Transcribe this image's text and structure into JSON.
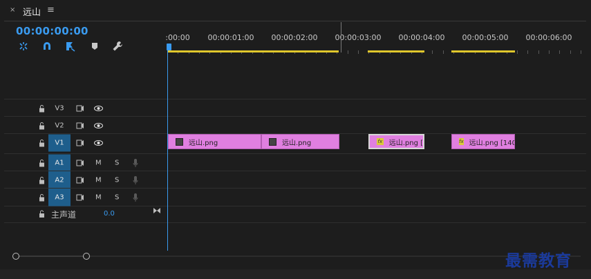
{
  "tab": {
    "close_glyph": "×",
    "title": "远山",
    "menu_glyph": "≡"
  },
  "timecode": "00:00:00:00",
  "tools": [
    "snap-in-icon",
    "linked-selection-icon",
    "add-marker-icon",
    "marker-icon",
    "wrench-settings-icon"
  ],
  "ruler": {
    "labels": [
      ":00:00",
      "00:00:01:00",
      "00:00:02:00",
      "00:00:03:00",
      "00:00:04:00",
      "00:00:05:00",
      "00:00:06:00"
    ]
  },
  "tracks": {
    "v3": {
      "label": "V3"
    },
    "v2": {
      "label": "V2"
    },
    "v1": {
      "label": "V1"
    },
    "a1": {
      "label": "A1",
      "mute": "M",
      "solo": "S"
    },
    "a2": {
      "label": "A2",
      "mute": "M",
      "solo": "S"
    },
    "a3": {
      "label": "A3",
      "mute": "M",
      "solo": "S"
    }
  },
  "master": {
    "label": "主声道",
    "value": "0.0"
  },
  "clips": [
    {
      "name": "远山.png",
      "icon": "image-icon"
    },
    {
      "name": "远山.png",
      "icon": "image-icon"
    },
    {
      "name": "远山.png [",
      "icon": "fx-icon",
      "fx": "fx"
    },
    {
      "name": "远山.png [140",
      "icon": "fx-icon",
      "fx": "fx"
    }
  ],
  "watermark": "最需教育",
  "colors": {
    "accent": "#3a9bf0",
    "clip": "#e07fe0",
    "workbar": "#e0c72c",
    "track_active": "#1e5e8c"
  }
}
